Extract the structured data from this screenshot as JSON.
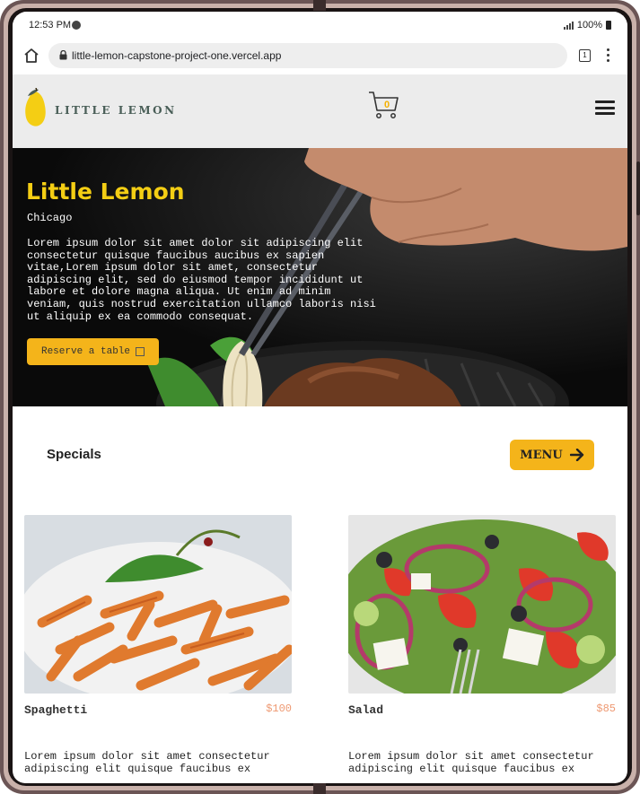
{
  "status_bar": {
    "time": "12:53 PM",
    "battery": "100%"
  },
  "browser": {
    "url": "little-lemon-capstone-project-one.vercel.app",
    "tab_count": "1"
  },
  "header": {
    "logo_text": "LITTLE LEMON",
    "cart_count": "0"
  },
  "hero": {
    "title": "Little Lemon",
    "city": "Chicago",
    "description": "Lorem ipsum dolor sit amet dolor sit adipiscing elit consectetur quisque faucibus aucibus ex sapien vitae,Lorem ipsum dolor sit amet, consectetur adipiscing elit, sed do eiusmod tempor incididunt ut labore et dolore magna aliqua. Ut enim ad minim veniam, quis nostrud exercitation ullamco laboris nisi ut aliquip ex ea commodo consequat.",
    "reserve_label": "Reserve a table"
  },
  "specials": {
    "title": "Specials",
    "menu_label": "MENU",
    "items": [
      {
        "name": "Spaghetti",
        "price": "$100",
        "description": "Lorem ipsum dolor sit amet consectetur adipiscing elit quisque faucibus ex"
      },
      {
        "name": "Salad",
        "price": "$85",
        "description": "Lorem ipsum dolor sit amet consectetur adipiscing elit quisque faucibus ex"
      }
    ]
  },
  "colors": {
    "primary_yellow": "#f4ce14",
    "button_yellow": "#f4b41a",
    "brand_green": "#495e57",
    "price_orange": "#ee9972"
  }
}
